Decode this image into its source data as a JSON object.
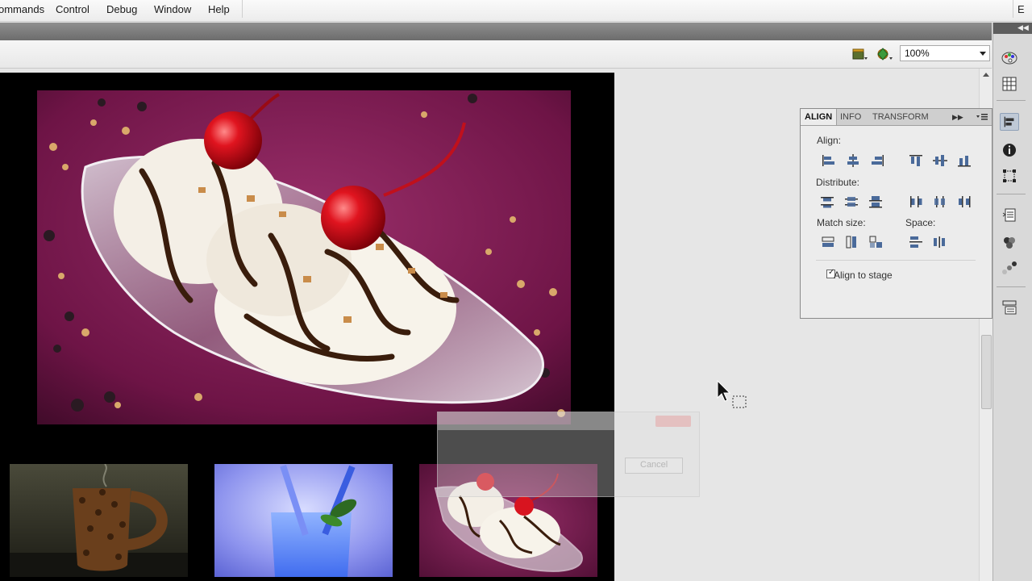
{
  "menu": {
    "items": [
      "ommands",
      "Control",
      "Debug",
      "Window",
      "Help"
    ],
    "right_label": "E"
  },
  "editbar": {
    "zoom": "100%",
    "edit_scene_icon": "clapperboard-icon",
    "edit_symbol_icon": "shapes-icon"
  },
  "stage": {
    "main_image": "ice-cream-sundae-with-cherries",
    "thumbnails": [
      "coffee-bean-mug",
      "blue-drink-with-straw",
      "ice-cream-sundae"
    ]
  },
  "ghost_dialog": {
    "button_label": "Cancel"
  },
  "align_panel": {
    "tabs": [
      "ALIGN",
      "INFO",
      "TRANSFORM"
    ],
    "align_label": "Align:",
    "distribute_label": "Distribute:",
    "match_size_label": "Match size:",
    "space_label": "Space:",
    "align_to_stage_label": "Align to stage",
    "align_to_stage_checked": true
  },
  "dock": {
    "icons": [
      "color-palette-icon",
      "swatches-grid-icon",
      "align-icon",
      "info-icon",
      "transform-icon",
      "library-icon",
      "components-icon",
      "motion-presets-icon",
      "project-icon"
    ]
  },
  "colors": {
    "accent": "#4a6a9a",
    "stage_bg": "#000000",
    "panel_bg": "#ececec"
  }
}
